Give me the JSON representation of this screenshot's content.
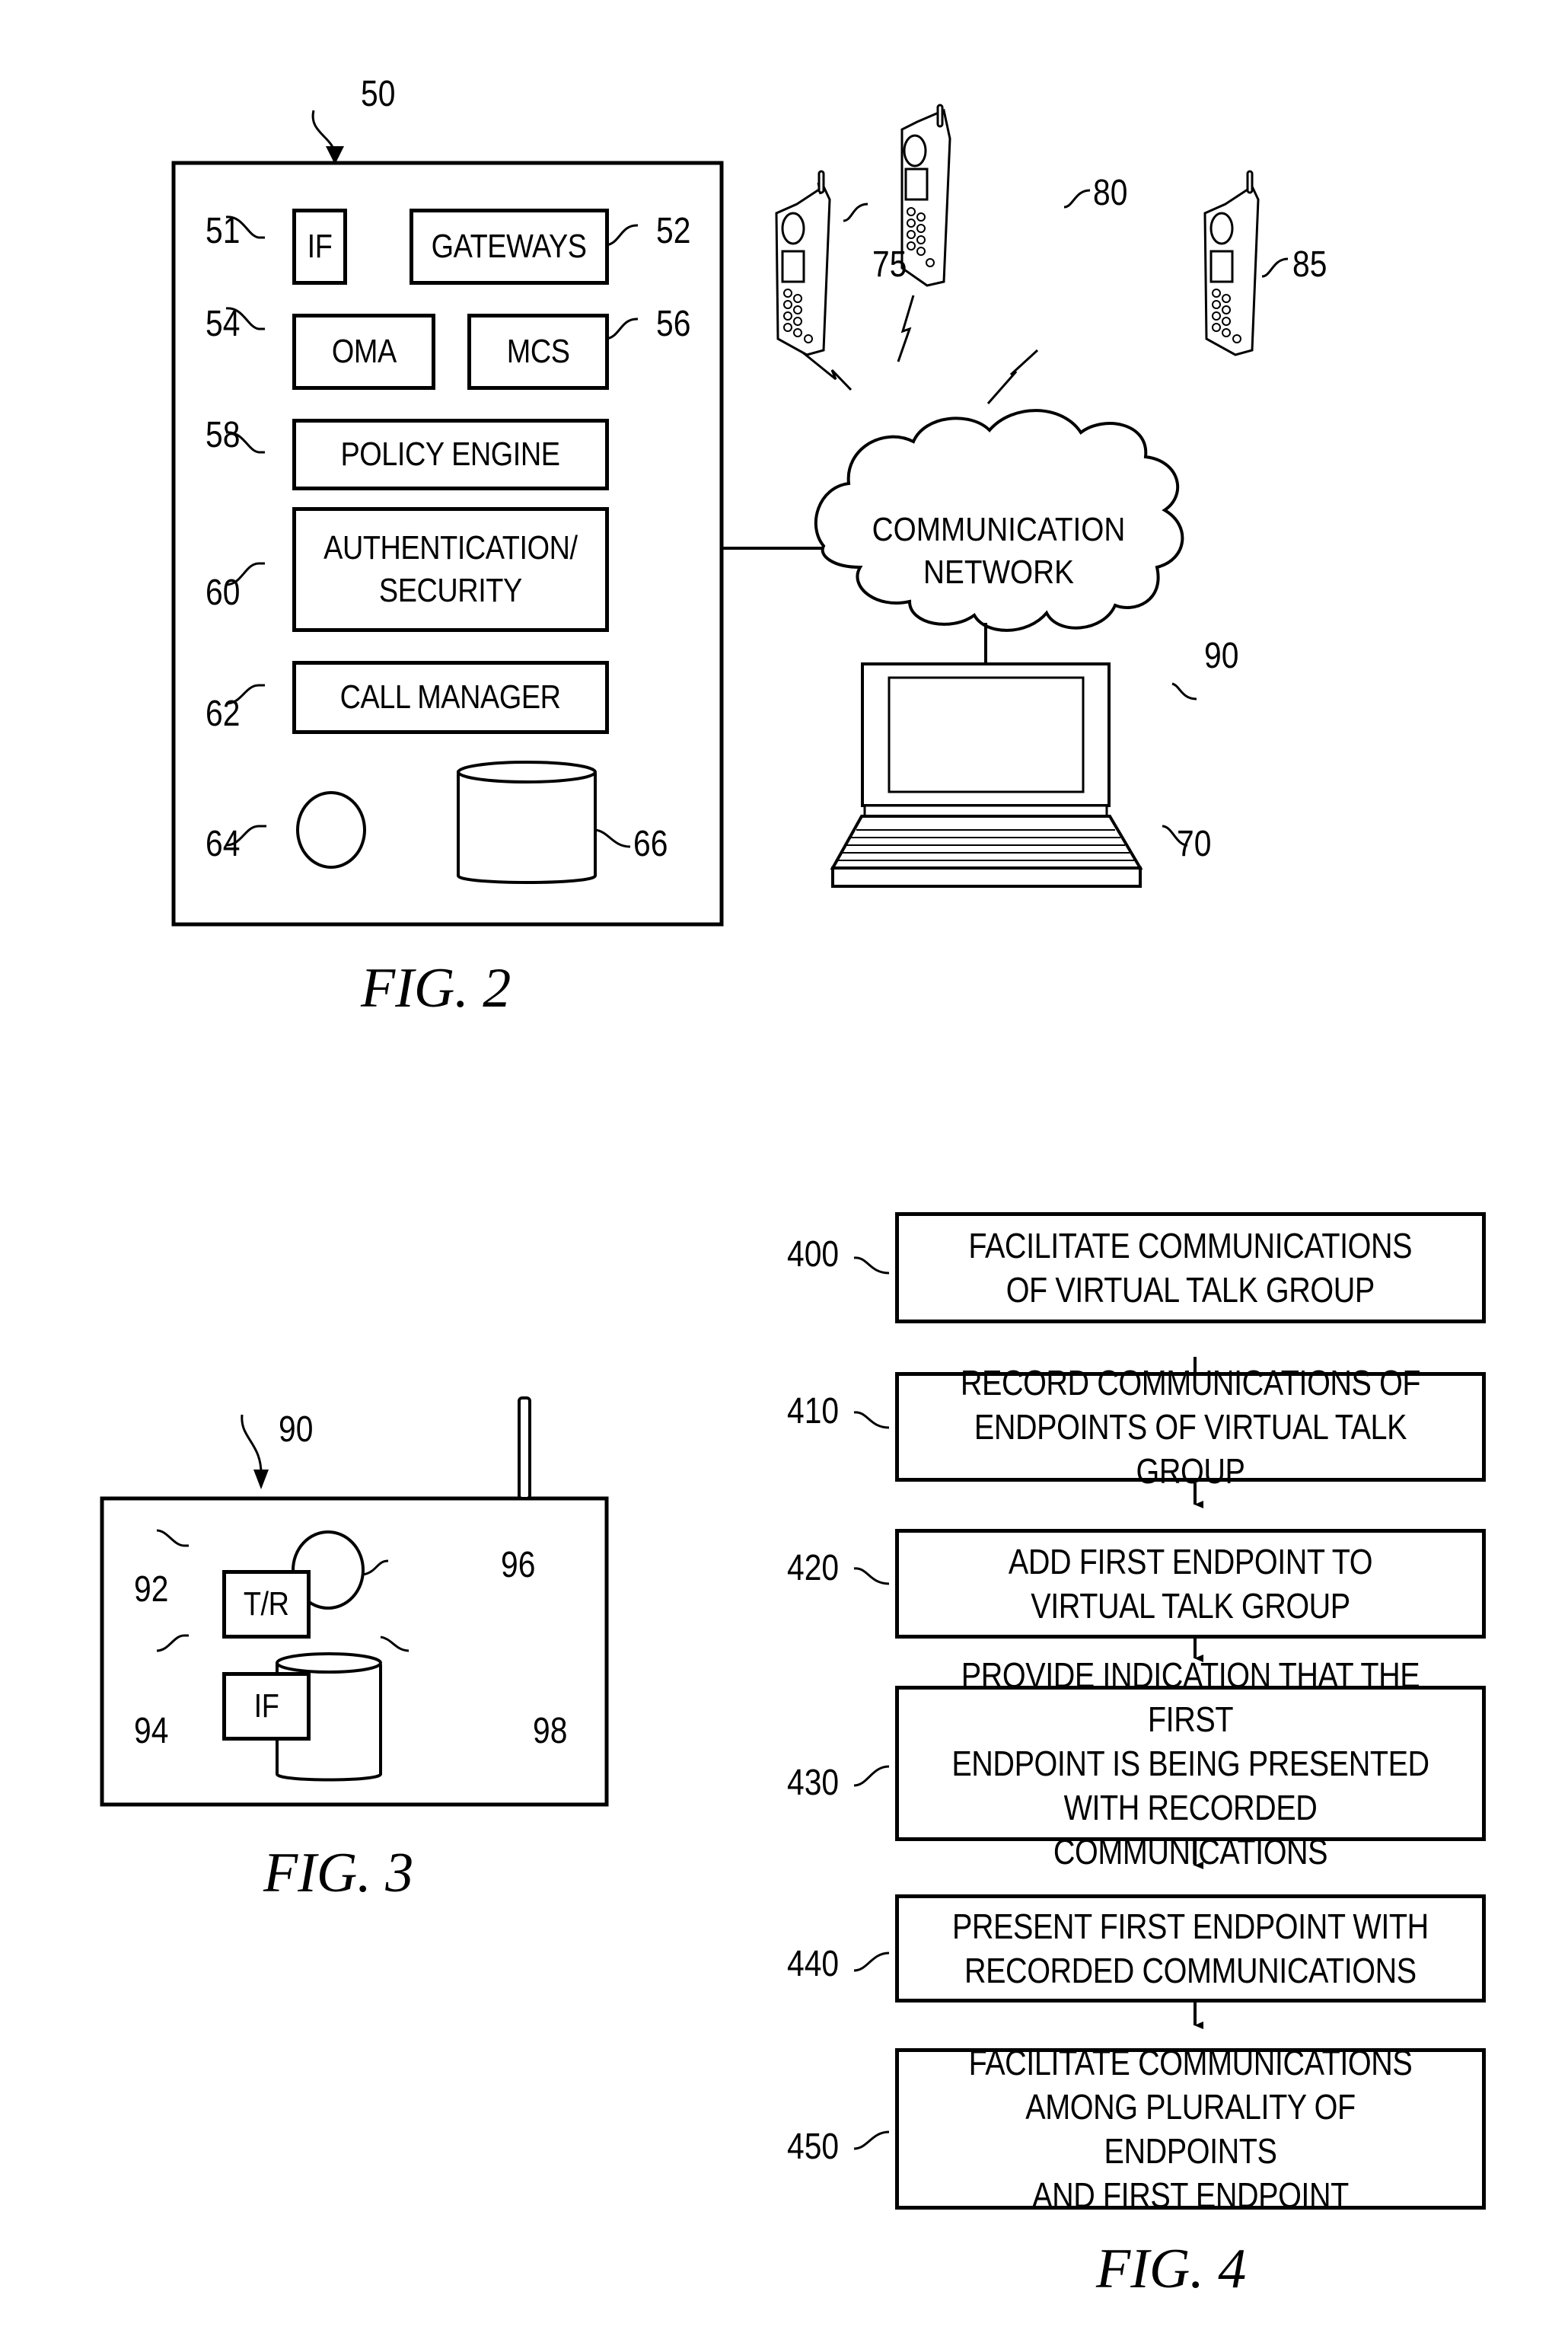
{
  "fig2": {
    "caption": "FIG. 2",
    "server": {
      "ref": "50",
      "components": [
        {
          "ref": "51",
          "label": "IF"
        },
        {
          "ref": "52",
          "label": "GATEWAYS"
        },
        {
          "ref": "54",
          "label": "OMA"
        },
        {
          "ref": "56",
          "label": "MCS"
        },
        {
          "ref": "58",
          "label": "POLICY ENGINE"
        },
        {
          "ref": "60",
          "label": "AUTHENTICATION/\nSECURITY"
        },
        {
          "ref": "62",
          "label": "CALL MANAGER"
        },
        {
          "ref": "64",
          "label": "",
          "shape": "circle"
        },
        {
          "ref": "66",
          "label": "",
          "shape": "cylinder"
        }
      ]
    },
    "network": {
      "ref": "90",
      "label": "COMMUNICATION\nNETWORK"
    },
    "phones": [
      {
        "ref": "75",
        "icon": "mobile-phone-icon"
      },
      {
        "ref": "80",
        "icon": "mobile-phone-icon"
      },
      {
        "ref": "85",
        "icon": "mobile-phone-icon"
      }
    ],
    "laptop": {
      "ref": "70",
      "icon": "laptop-icon"
    }
  },
  "fig3": {
    "caption": "FIG. 3",
    "device": {
      "ref": "90",
      "components": [
        {
          "ref": "92",
          "label": "T/R"
        },
        {
          "ref": "94",
          "label": "IF"
        },
        {
          "ref": "96",
          "label": "",
          "shape": "circle"
        },
        {
          "ref": "98",
          "label": "",
          "shape": "cylinder"
        }
      ]
    }
  },
  "fig4": {
    "caption": "FIG. 4",
    "steps": [
      {
        "ref": "400",
        "label": "FACILITATE COMMUNICATIONS\nOF VIRTUAL TALK GROUP"
      },
      {
        "ref": "410",
        "label": "RECORD COMMUNICATIONS OF\nENDPOINTS OF VIRTUAL TALK GROUP"
      },
      {
        "ref": "420",
        "label": "ADD FIRST ENDPOINT TO\nVIRTUAL TALK GROUP"
      },
      {
        "ref": "430",
        "label": "PROVIDE INDICATION THAT THE FIRST\nENDPOINT IS BEING PRESENTED\nWITH RECORDED COMMUNICATIONS"
      },
      {
        "ref": "440",
        "label": "PRESENT FIRST ENDPOINT WITH\nRECORDED COMMUNICATIONS"
      },
      {
        "ref": "450",
        "label": "FACILITATE COMMUNICATIONS\nAMONG PLURALITY OF ENDPOINTS\nAND FIRST ENDPOINT"
      }
    ]
  }
}
